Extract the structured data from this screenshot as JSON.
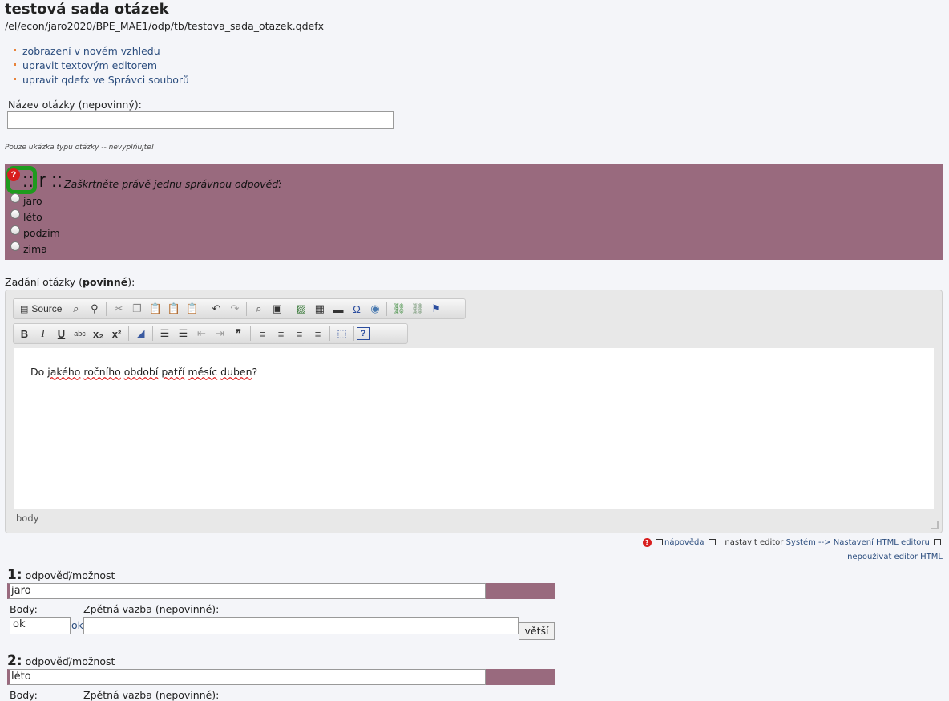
{
  "header": {
    "title": "testová sada otázek",
    "path": "/el/econ/jaro2020/BPE_MAE1/odp/tb/testova_sada_otazek.qdefx"
  },
  "links": [
    "zobrazení v novém vzhledu",
    "upravit textovým editorem",
    "upravit qdefx ve Správci souborů"
  ],
  "question_name": {
    "label": "Název otázky (nepovinný):",
    "value": ""
  },
  "preview": {
    "note": "Pouze ukázka typu otázky -- nevyplňujte!",
    "help_glyph": "?",
    "type_marker": ":: r ::",
    "instruction": "Zaškrtněte právě jednu správnou odpověď:",
    "options": [
      "jaro",
      "léto",
      "podzim",
      "zima"
    ],
    "accent_color": "#996a7e",
    "highlight_color": "#1e9b1e"
  },
  "editor": {
    "label_plain": "Zadání otázky (",
    "label_bold": "povinné",
    "label_end": "):",
    "toolbar1": {
      "source_label": "Source",
      "icons": [
        "source-icon",
        "preview-icon",
        "find-icon",
        "cut-icon",
        "copy-icon",
        "paste-icon",
        "paste-text-icon",
        "paste-word-icon",
        "undo-icon",
        "redo-icon",
        "find-replace-icon",
        "select-all-icon",
        "image-icon",
        "table-icon",
        "horizontal-rule-icon",
        "special-char-icon",
        "globe-icon",
        "link-icon",
        "unlink-icon",
        "anchor-flag-icon"
      ]
    },
    "toolbar2": {
      "bold": "B",
      "italic": "I",
      "underline": "U",
      "strike": "abc",
      "subscript": "x₂",
      "superscript": "x²",
      "quote": "❞",
      "help": "?"
    },
    "content": {
      "w1": "Do ",
      "w2": "jakého",
      "w3": " ",
      "w4": "ročního",
      "w5": " ",
      "w6": "období",
      "w7": " ",
      "w8": "patří",
      "w9": " ",
      "w10": "měsíc",
      "w11": " ",
      "w12": "duben",
      "w13": "?"
    },
    "status_path": "body",
    "help_link": "nápověda",
    "sep": "|",
    "settings_prefix": "nastavit editor",
    "settings_link": "Systém --> Nastavení HTML editoru",
    "disable_link": "nepoužívat editor HTML"
  },
  "answers": [
    {
      "number": "1:",
      "head_label": "odpověď/možnost",
      "value": "jaro",
      "points_label": "Body:",
      "points_value": "ok",
      "ok_link": "ok",
      "feedback_label": "Zpětná vazba (nepovinné):",
      "bigger_label": "větší"
    },
    {
      "number": "2:",
      "head_label": "odpověď/možnost",
      "value": "léto",
      "points_label": "Body:",
      "feedback_label": "Zpětná vazba (nepovinné):"
    }
  ]
}
